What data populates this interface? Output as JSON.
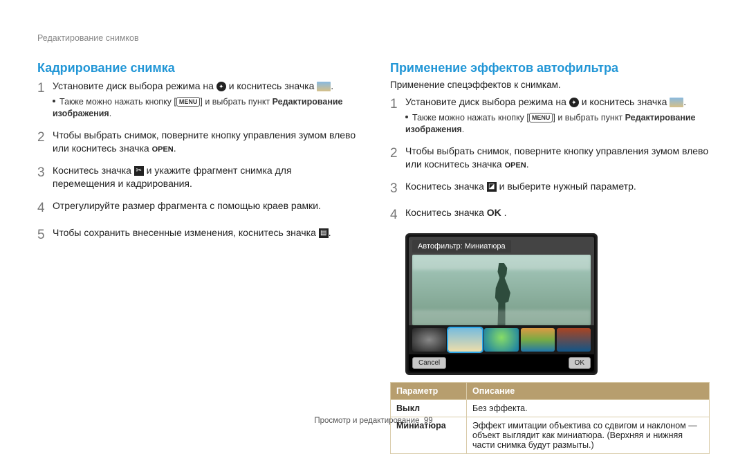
{
  "breadcrumb": "Редактирование снимков",
  "left": {
    "title": "Кадрирование снимка",
    "steps": [
      {
        "n": "1",
        "pre": "Установите диск выбора режима на",
        "mid": "и коснитесь значка",
        "sub_a": "Также можно нажать кнопку [",
        "sub_menu": "MENU",
        "sub_b": "] и выбрать пункт ",
        "sub_bold": "Редактирование изображения",
        "end": "."
      },
      {
        "n": "2",
        "text_a": "Чтобы выбрать снимок, поверните кнопку управления зумом влево или коснитесь значка ",
        "open": "OPEN",
        "end": "."
      },
      {
        "n": "3",
        "text_a": "Коснитесь значка ",
        "text_b": " и укажите фрагмент снимка для перемещения и кадрирования."
      },
      {
        "n": "4",
        "text": "Отрегулируйте размер фрагмента с помощью краев рамки."
      },
      {
        "n": "5",
        "text_a": "Чтобы сохранить внесенные изменения, коснитесь значка ",
        "end": "."
      }
    ]
  },
  "right": {
    "title": "Применение эффектов автофильтра",
    "intro": "Применение спецэффектов к снимкам.",
    "steps": [
      {
        "n": "1",
        "pre": "Установите диск выбора режима на",
        "mid": "и коснитесь значка",
        "sub_a": "Также можно нажать кнопку [",
        "sub_menu": "MENU",
        "sub_b": "] и выбрать пункт ",
        "sub_bold": "Редактирование изображения",
        "end": "."
      },
      {
        "n": "2",
        "text_a": "Чтобы выбрать снимок, поверните кнопку управления зумом влево или коснитесь значка ",
        "open": "OPEN",
        "end": "."
      },
      {
        "n": "3",
        "text_a": "Коснитесь значка ",
        "text_b": " и выберите нужный параметр."
      },
      {
        "n": "4",
        "text_a": "Коснитесь значка ",
        "ok": "OK",
        "end": " ."
      }
    ],
    "screen": {
      "label": "Автофильтр: Миниатюра",
      "cancel": "Cancel",
      "ok": "OK"
    },
    "table": {
      "h1": "Параметр",
      "h2": "Описание",
      "rows": [
        {
          "p": "Выкл",
          "d": "Без эффекта."
        },
        {
          "p": "Миниатюра",
          "d": "Эффект имитации объектива со сдвигом и наклоном — объект выглядит как миниатюра. (Верхняя и нижняя части снимка будут размыты.)"
        }
      ]
    }
  },
  "footer": {
    "label": "Просмотр и редактирование",
    "page": "99"
  }
}
